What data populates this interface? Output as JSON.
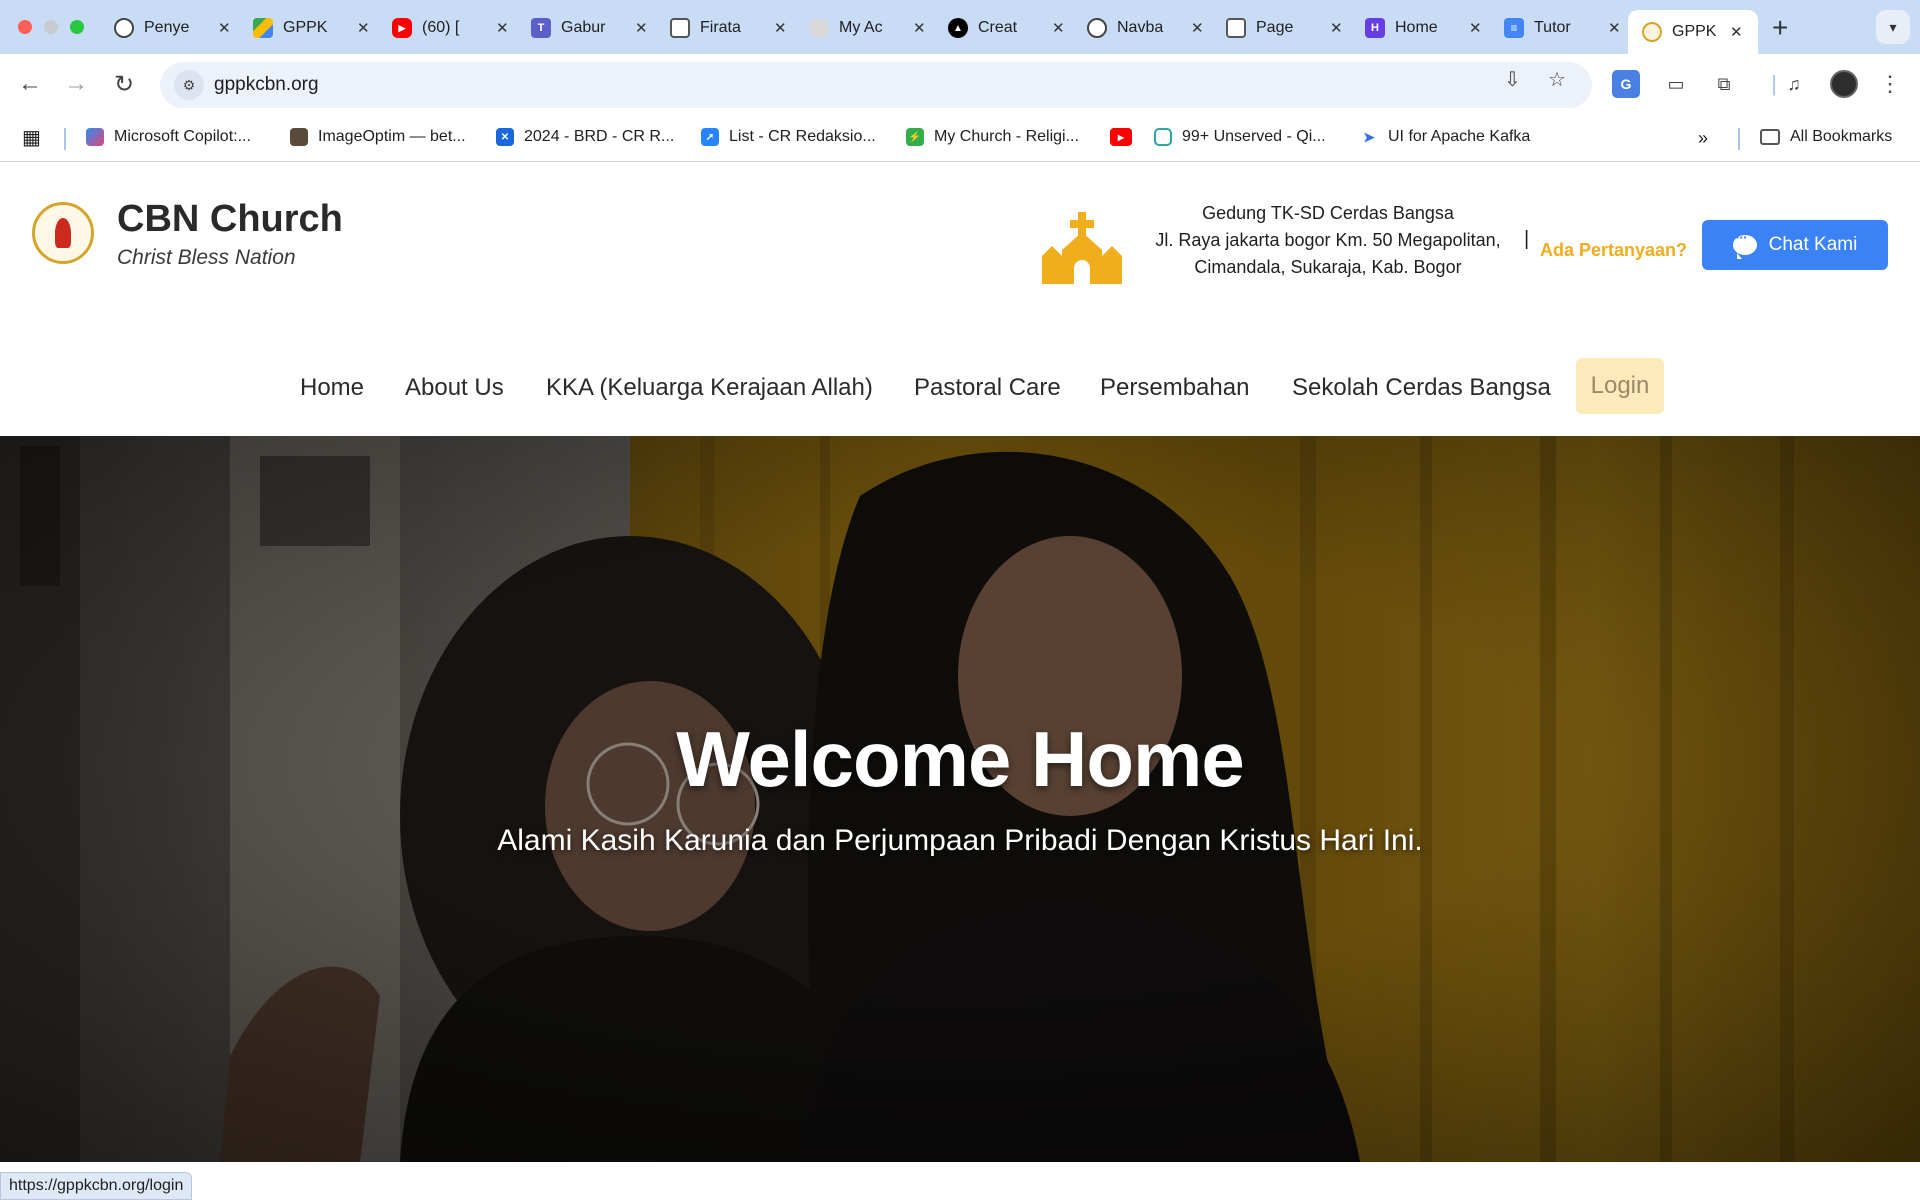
{
  "browser": {
    "tabs": [
      {
        "title": "Penye",
        "favicon": "openai-icon"
      },
      {
        "title": "GPPK",
        "favicon": "google-drive-icon"
      },
      {
        "title": "(60) [",
        "favicon": "youtube-icon"
      },
      {
        "title": "Gabur",
        "favicon": "teams-icon"
      },
      {
        "title": "Firata",
        "favicon": "page-icon"
      },
      {
        "title": "My Ac",
        "favicon": "globe-icon"
      },
      {
        "title": "Creat",
        "favicon": "vercel-icon"
      },
      {
        "title": "Navba",
        "favicon": "openai-icon"
      },
      {
        "title": "Page",
        "favicon": "page-icon"
      },
      {
        "title": "Home",
        "favicon": "hostinger-icon"
      },
      {
        "title": "Tutor",
        "favicon": "docs-icon"
      },
      {
        "title": "GPPK",
        "favicon": "church-logo-icon",
        "active": true
      }
    ],
    "url": "gppkcbn.org",
    "bookmarks": [
      {
        "label": "Microsoft Copilot:...",
        "icon": "copilot-icon"
      },
      {
        "label": "ImageOptim — bet...",
        "icon": "imageoptim-icon"
      },
      {
        "label": "2024 - BRD - CR R...",
        "icon": "confluence-icon"
      },
      {
        "label": "List - CR Redaksio...",
        "icon": "jira-icon"
      },
      {
        "label": "My Church - Religi...",
        "icon": "church-app-icon"
      },
      {
        "label": "",
        "icon": "youtube-icon"
      },
      {
        "label": "99+ Unserved - Qi...",
        "icon": "qiscus-icon"
      },
      {
        "label": "UI for Apache Kafka",
        "icon": "kafka-icon"
      }
    ],
    "all_bookmarks_label": "All Bookmarks",
    "status_url": "https://gppkcbn.org/login"
  },
  "site": {
    "brand": {
      "title": "CBN Church",
      "subtitle": "Christ Bless Nation"
    },
    "address": {
      "line1": "Gedung TK-SD Cerdas Bangsa",
      "line2": "Jl. Raya jakarta bogor Km. 50 Megapolitan,",
      "line3": "Cimandala, Sukaraja, Kab. Bogor"
    },
    "address_separator": "|",
    "ask_label": "Ada Pertanyaan?",
    "chat_label": "Chat Kami",
    "nav": {
      "home": "Home",
      "about": "About Us",
      "kka": "KKA (Keluarga Kerajaan Allah)",
      "pastoral": "Pastoral Care",
      "persembahan": "Persembahan",
      "sekolah": "Sekolah Cerdas Bangsa",
      "login": "Login"
    },
    "hero": {
      "title": "Welcome Home",
      "subtitle": "Alami Kasih Karunia dan Perjumpaan Pribadi Dengan Kristus Hari Ini."
    }
  },
  "colors": {
    "tab_strip": "#c9dcf6",
    "accent_blue": "#3b82f6",
    "accent_gold": "#f0ad1c",
    "login_bg": "#fdeabb"
  }
}
